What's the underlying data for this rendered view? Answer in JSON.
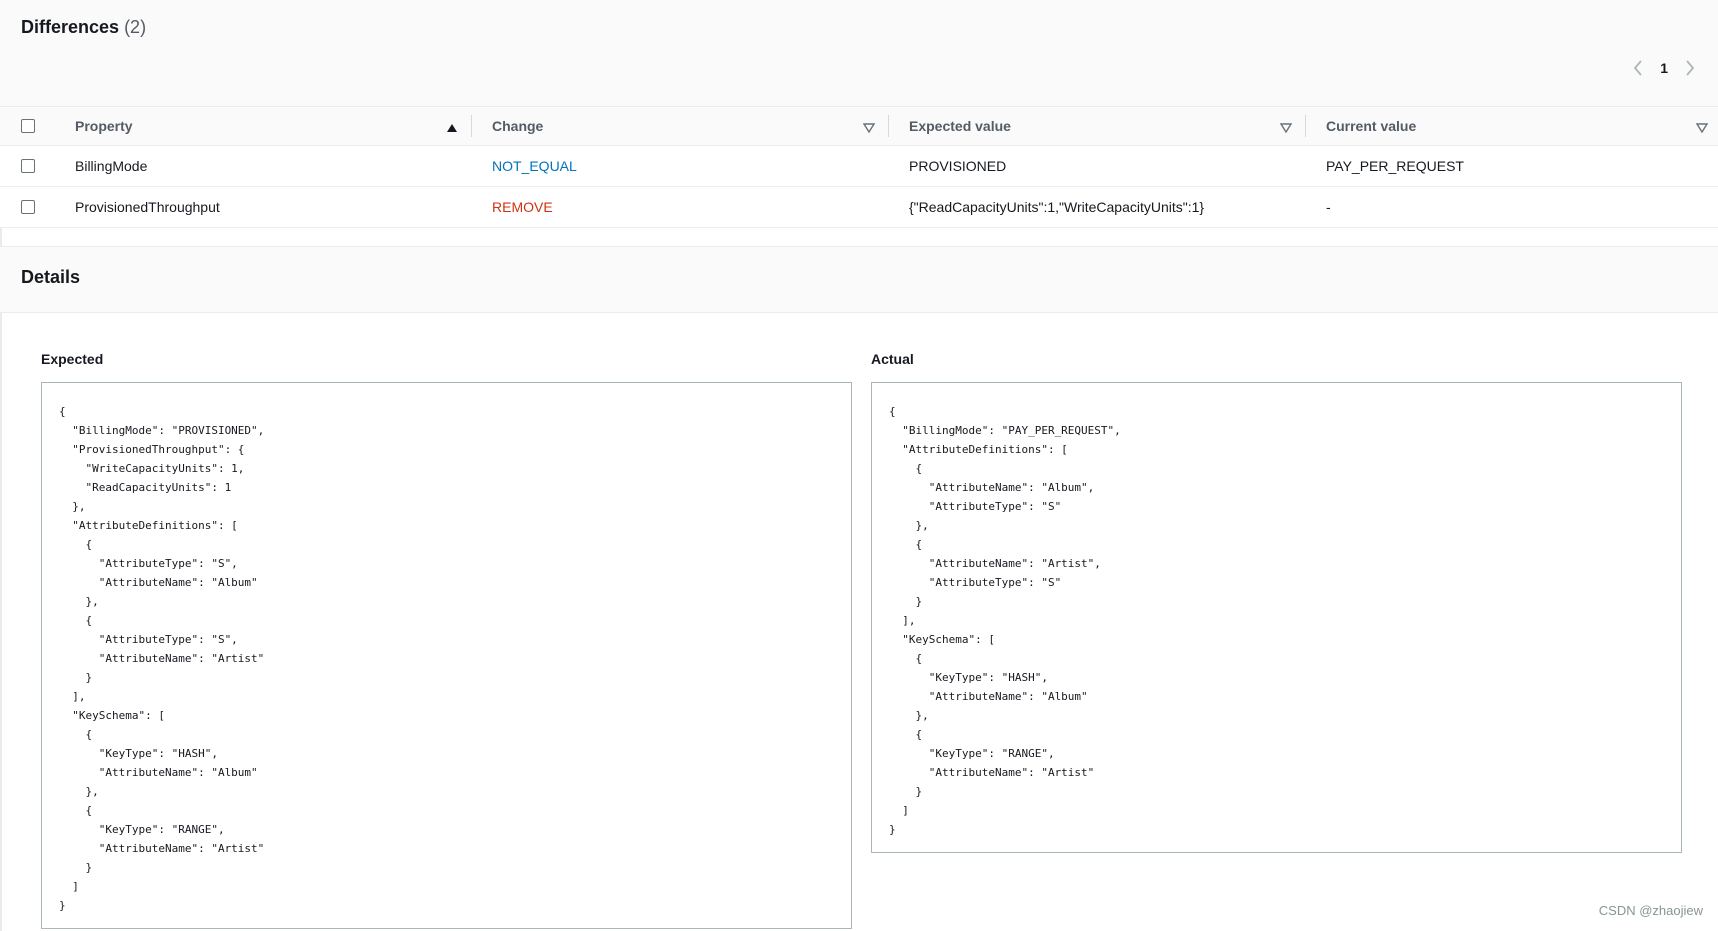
{
  "differences": {
    "title": "Differences",
    "count": "(2)",
    "pagination": {
      "current_page": "1"
    }
  },
  "table": {
    "columns": {
      "property": "Property",
      "change": "Change",
      "expected": "Expected value",
      "current": "Current value"
    },
    "rows": [
      {
        "property": "BillingMode",
        "change": "NOT_EQUAL",
        "expected": "PROVISIONED",
        "current": "PAY_PER_REQUEST"
      },
      {
        "property": "ProvisionedThroughput",
        "change": "REMOVE",
        "expected": "{\"ReadCapacityUnits\":1,\"WriteCapacityUnits\":1}",
        "current": "-"
      }
    ]
  },
  "details": {
    "title": "Details",
    "expected_label": "Expected",
    "actual_label": "Actual",
    "expected_json": "{\n  \"BillingMode\": \"PROVISIONED\",\n  \"ProvisionedThroughput\": {\n    \"WriteCapacityUnits\": 1,\n    \"ReadCapacityUnits\": 1\n  },\n  \"AttributeDefinitions\": [\n    {\n      \"AttributeType\": \"S\",\n      \"AttributeName\": \"Album\"\n    },\n    {\n      \"AttributeType\": \"S\",\n      \"AttributeName\": \"Artist\"\n    }\n  ],\n  \"KeySchema\": [\n    {\n      \"KeyType\": \"HASH\",\n      \"AttributeName\": \"Album\"\n    },\n    {\n      \"KeyType\": \"RANGE\",\n      \"AttributeName\": \"Artist\"\n    }\n  ]\n}",
    "actual_json": "{\n  \"BillingMode\": \"PAY_PER_REQUEST\",\n  \"AttributeDefinitions\": [\n    {\n      \"AttributeName\": \"Album\",\n      \"AttributeType\": \"S\"\n    },\n    {\n      \"AttributeName\": \"Artist\",\n      \"AttributeType\": \"S\"\n    }\n  ],\n  \"KeySchema\": [\n    {\n      \"KeyType\": \"HASH\",\n      \"AttributeName\": \"Album\"\n    },\n    {\n      \"KeyType\": \"RANGE\",\n      \"AttributeName\": \"Artist\"\n    }\n  ]\n}"
  },
  "watermark": "CSDN @zhaojiew",
  "colors": {
    "not_equal": "#0073bb",
    "remove": "#d13212"
  }
}
